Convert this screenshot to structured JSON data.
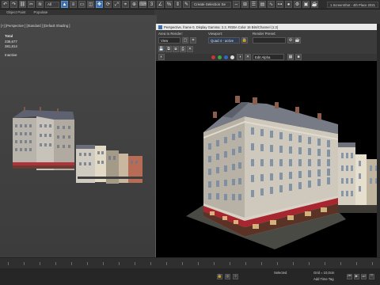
{
  "toolbar": {
    "filter_select": "All",
    "selection_set": "Create Selection Se",
    "user_info": "1 ScreenShot - 4th Place 2021"
  },
  "strip": {
    "object_paint": "Object Paint",
    "populate": "Populate"
  },
  "viewport": {
    "label": "[+] [Perspective ] [Standard ] [Default Shading ]",
    "stats_header": "Total",
    "polys": "236,677",
    "verts": "381,814",
    "inactive": "Inactive"
  },
  "render_window": {
    "title": "Perspective, frame 0, Display Gamma: 2.2, RGBA Color 16 Bits/Channel (1:2)",
    "area_to_render_label": "Area to Render:",
    "area_to_render_value": "View",
    "viewport_label": "Viewport:",
    "viewport_value": "Quad 4 - active",
    "render_preset_label": "Render Preset:",
    "render_preset_value": "",
    "channel_select": "RGB Alpha",
    "edit_select": "Edit Alpha"
  },
  "status": {
    "grid": "Grid = 10,0cm",
    "add_time_tag": "Add Time Tag",
    "selected": "Selected"
  },
  "colors": {
    "accent": "#3d6fa8",
    "dot_red": "#cc3333",
    "dot_green": "#33aa44",
    "dot_blue": "#3366cc"
  }
}
